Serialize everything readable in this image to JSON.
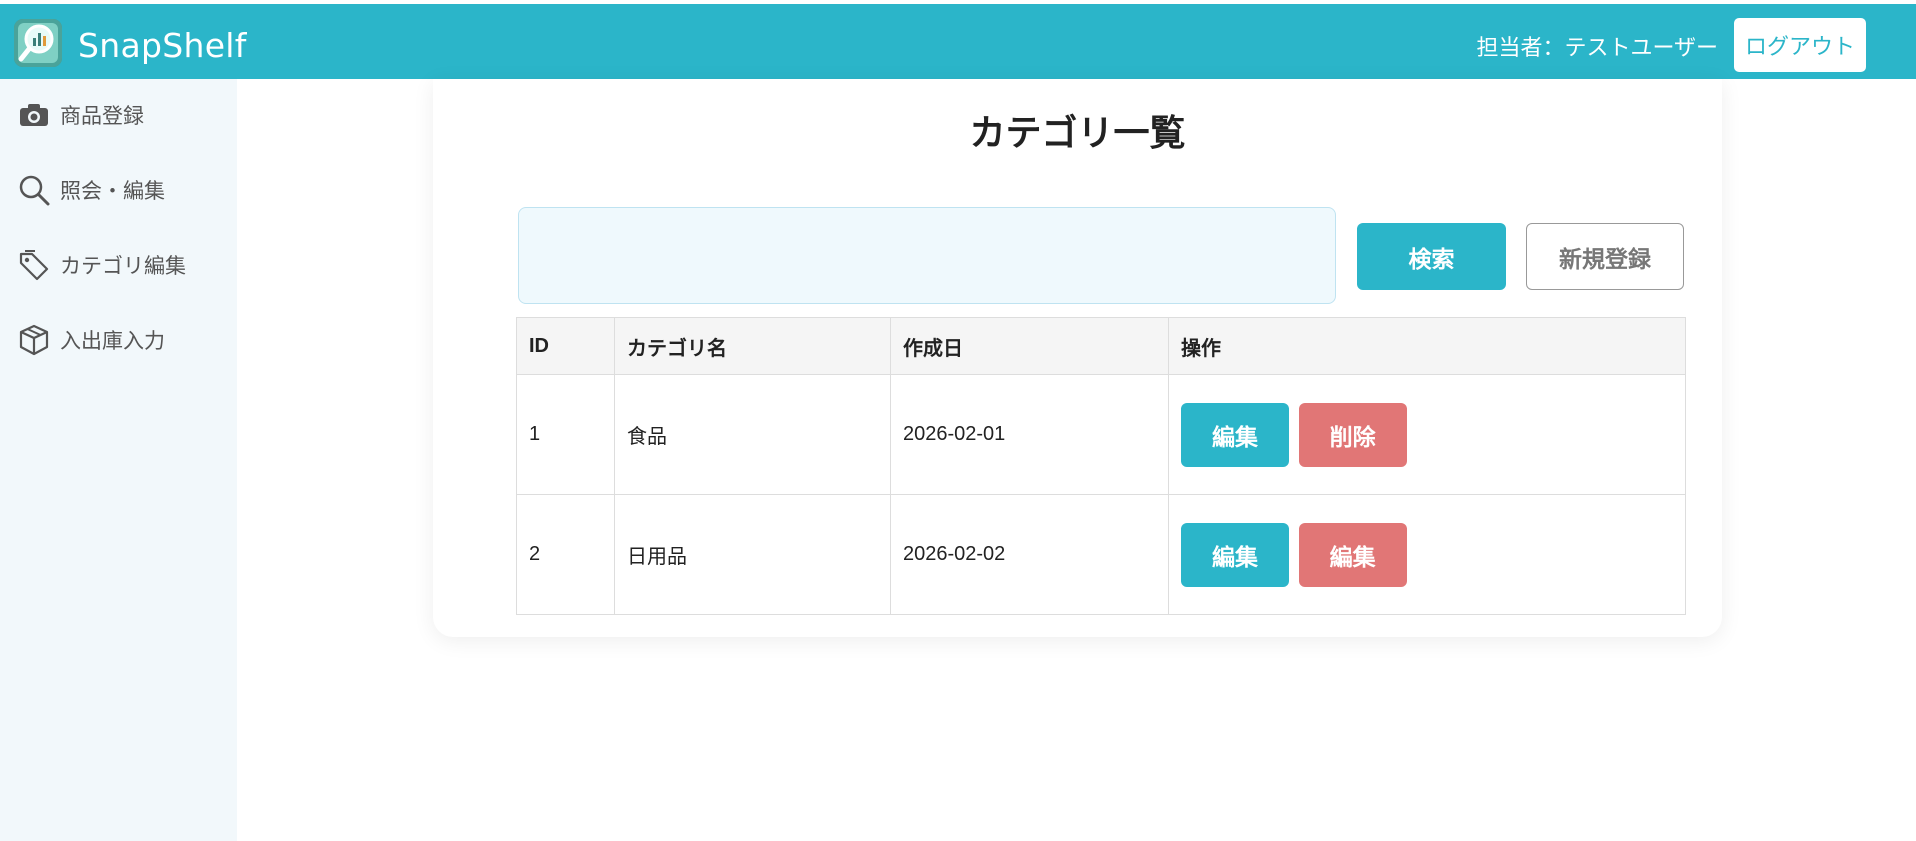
{
  "header": {
    "app_name": "SnapShelf",
    "user_label": "担当者：テストユーザー",
    "logout_label": "ログアウト",
    "accent_color": "#2bb5c9",
    "logo_icon": "magnifier-chart-icon"
  },
  "sidebar": {
    "items": [
      {
        "label": "商品登録",
        "icon": "camera-icon"
      },
      {
        "label": "照会・編集",
        "icon": "search-icon"
      },
      {
        "label": "カテゴリ編集",
        "icon": "tag-icon"
      },
      {
        "label": "入出庫入力",
        "icon": "box-icon"
      }
    ]
  },
  "main": {
    "title": "カテゴリ一覧",
    "search": {
      "value": "",
      "placeholder": "",
      "button_label": "検索"
    },
    "new_button_label": "新規登録",
    "table": {
      "columns": [
        "ID",
        "カテゴリ名",
        "作成日",
        "操作"
      ],
      "rows": [
        {
          "id": "1",
          "name": "食品",
          "created": "2026-02-01",
          "actions": [
            "編集",
            "削除"
          ]
        },
        {
          "id": "2",
          "name": "日用品",
          "created": "2026-02-02",
          "actions": [
            "編集",
            "編集"
          ]
        }
      ]
    },
    "colors": {
      "edit": "#2bb5c9",
      "delete": "#e17676"
    }
  }
}
